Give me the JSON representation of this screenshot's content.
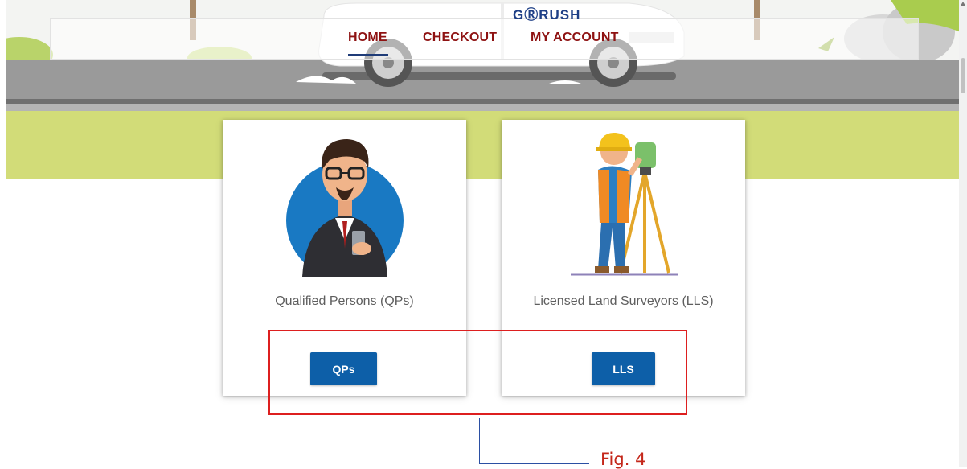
{
  "header": {
    "logo_text": "GⓇRUSH",
    "nav": {
      "home": "HOME",
      "checkout": "CHECKOUT",
      "my_account": "MY ACCOUNT"
    }
  },
  "cards": [
    {
      "label": "Qualified Persons (QPs)",
      "button": "QPs",
      "icon": "business-person-illustration"
    },
    {
      "label": "Licensed Land Surveyors (LLS)",
      "button": "LLS",
      "icon": "land-surveyor-illustration"
    }
  ],
  "annotation": {
    "caption": "Fig. 4"
  },
  "colors": {
    "nav_text": "#8e1212",
    "button_bg": "#0d5fa8",
    "annotation_box": "#dd1f1f",
    "grass": "#d2dc78",
    "road": "#9a9a9a"
  }
}
